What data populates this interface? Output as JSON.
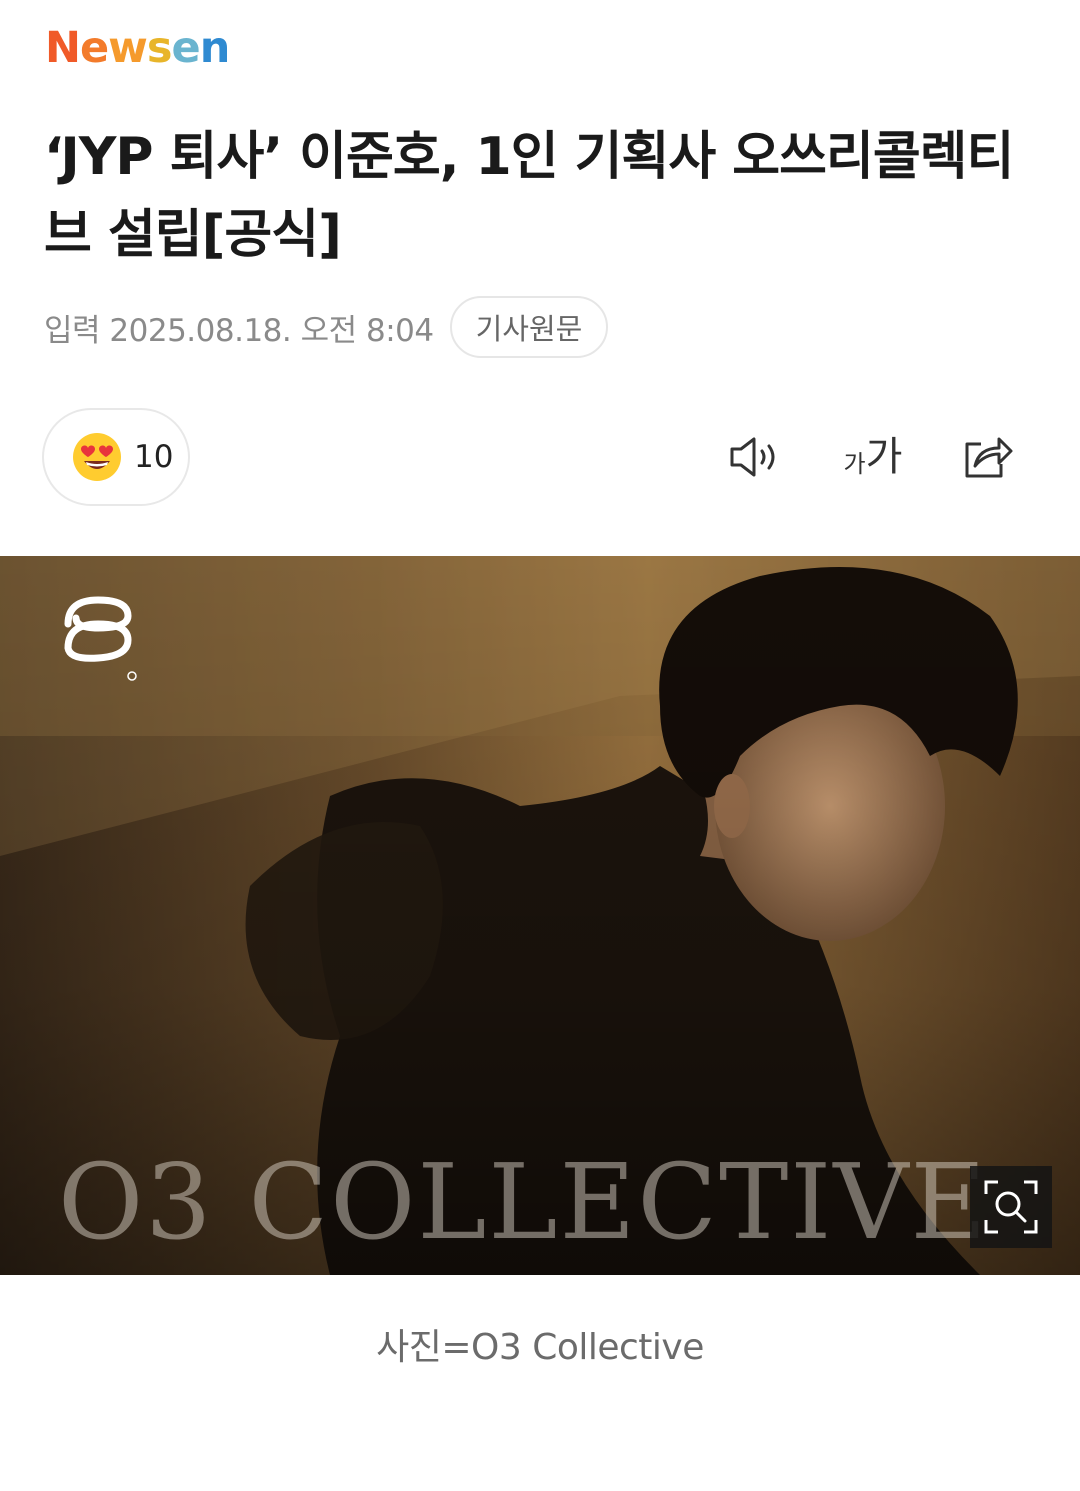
{
  "header": {
    "logo_letters": [
      "N",
      "e",
      "w",
      "s",
      "e",
      "n"
    ]
  },
  "article": {
    "title": "‘JYP 퇴사’ 이준호, 1인 기획사 오쓰리콜렉티브 설립[공식]",
    "date_label": "입력 2025.08.18. 오전 8:04",
    "original_button": "기사원문",
    "reaction_icon": "heart-eyes-emoji",
    "reaction_count": "10",
    "font_small": "가",
    "font_big": "가",
    "photo_logo_icon": "o3-collective-logo",
    "photo_text": "O3 COLLECTIVE",
    "caption": "사진=O3 Collective"
  },
  "colors": {
    "logo": [
      "#f05a28",
      "#f37b2b",
      "#f59a2c",
      "#e8b52a",
      "#6ab4cf",
      "#2f8ad1"
    ],
    "title": "#1a1a1a",
    "meta": "#8a8a8a",
    "caption": "#6b6b6b"
  }
}
